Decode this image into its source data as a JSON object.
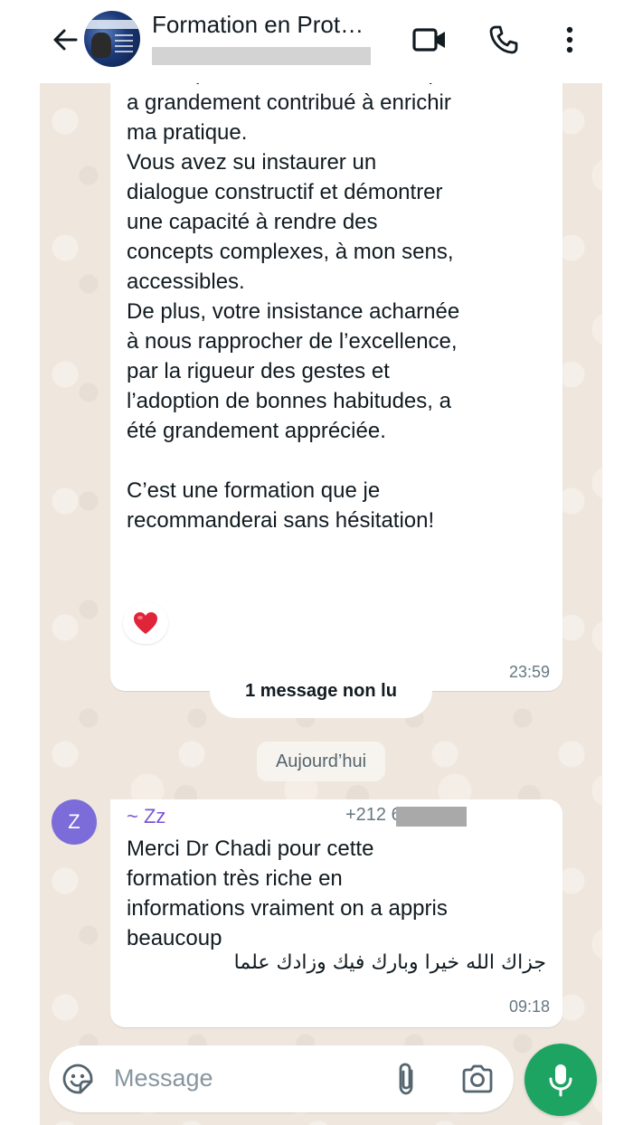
{
  "header": {
    "title": "Formation en Prot…",
    "back_icon": "arrow-left-icon",
    "video_icon": "video-camera-icon",
    "call_icon": "phone-icon",
    "menu_icon": "more-vertical-icon"
  },
  "messages": [
    {
      "text": "Une expertise dans la matière qui\na grandement contribué à enrichir\nma pratique.\nVous avez su instaurer un\ndialogue constructif et démontrer\nune capacité à rendre des\nconcepts complexes, à mon sens,\naccessibles.\nDe plus, votre insistance acharnée\nà nous rapprocher de l’excellence,\npar la rigueur des gestes et\nl’adoption de bonnes habitudes, a\nété grandement appréciée.\n\nC’est une formation que je\nrecommanderai sans hésitation!",
      "time": "23:59",
      "reaction": "❤️"
    },
    {
      "sender_initial": "Z",
      "sender_name": "~ Zz",
      "sender_phone": "+212 6          732",
      "text": "Merci Dr Chadi pour cette\nformation très riche en\ninformations vraiment on a appris\nbeaucoup",
      "arabic_text": "جزاك الله خيرا وبارك فيك وزادك علما",
      "time": "09:18"
    }
  ],
  "unread_banner": "1 message non lu",
  "date_divider": "Aujourd’hui",
  "composer": {
    "placeholder": "Message",
    "emoji_icon": "sticker-icon",
    "attach_icon": "paperclip-icon",
    "camera_icon": "camera-icon",
    "mic_icon": "microphone-icon"
  },
  "colors": {
    "chat_bg": "#efe7dd",
    "accent_green": "#1da462",
    "sender_purple": "#7b55d6",
    "avatar_purple": "#7b6cd9"
  }
}
